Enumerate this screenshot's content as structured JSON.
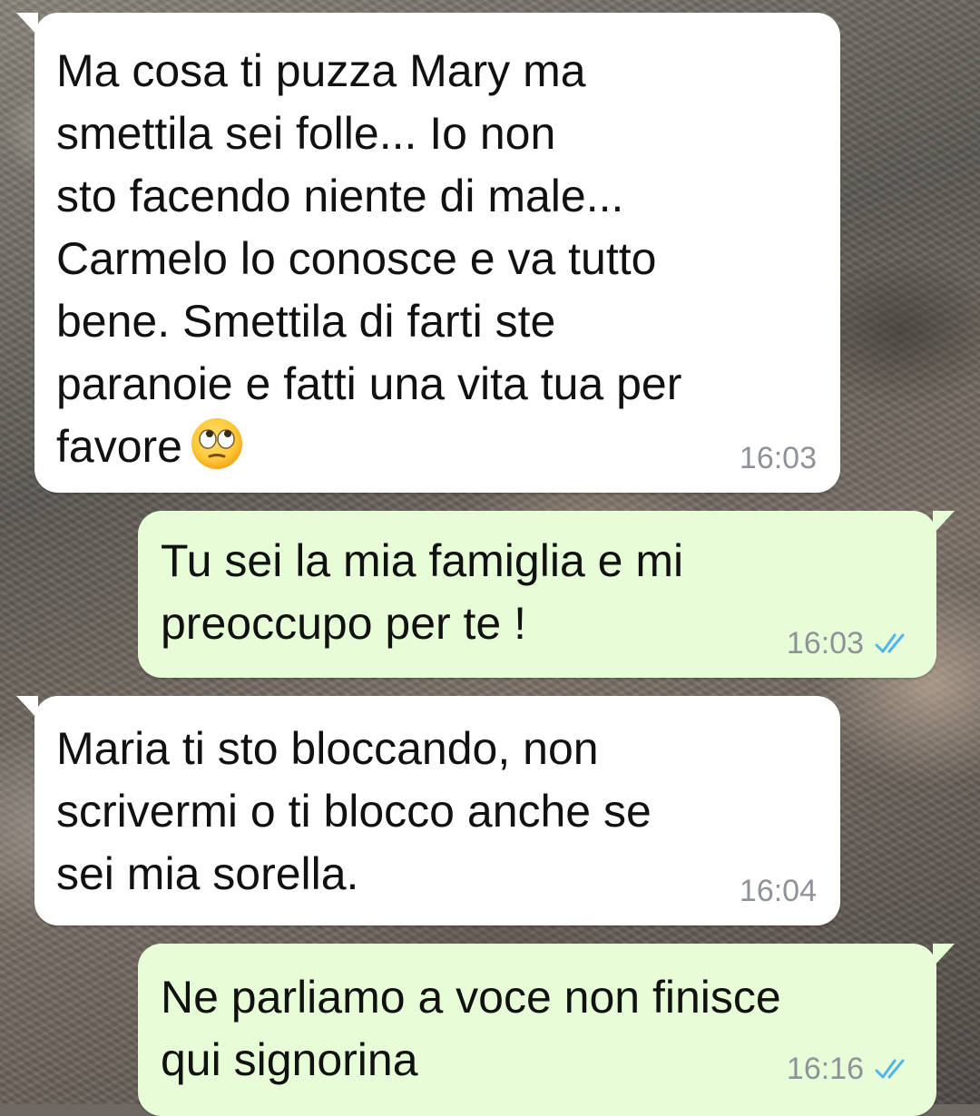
{
  "chat": {
    "messages": [
      {
        "direction": "incoming",
        "text": "Ma cosa ti puzza Mary ma\nsmettila sei folle... Io non\nsto facendo niente di male...\nCarmelo lo conosce e va tutto\nbene. Smettila di farti ste\nparanoie e fatti una vita tua per\nfavore",
        "emoji": "face-with-rolling-eyes",
        "time": "16:03"
      },
      {
        "direction": "outgoing",
        "text": "Tu sei la mia famiglia e mi\npreoccupo per te !",
        "time": "16:03",
        "status": "read"
      },
      {
        "direction": "incoming",
        "text": "Maria ti sto bloccando, non\nscrivermi o ti blocco anche se\nsei mia sorella.",
        "time": "16:04"
      },
      {
        "direction": "outgoing",
        "text": "Ne parliamo a voce non finisce\nqui signorina",
        "time": "16:16",
        "status": "read"
      }
    ]
  },
  "colors": {
    "incoming_bubble": "#ffffff",
    "outgoing_bubble": "#e7fdd7",
    "timestamp": "#8f9399",
    "read_ticks": "#4fb6ec"
  }
}
